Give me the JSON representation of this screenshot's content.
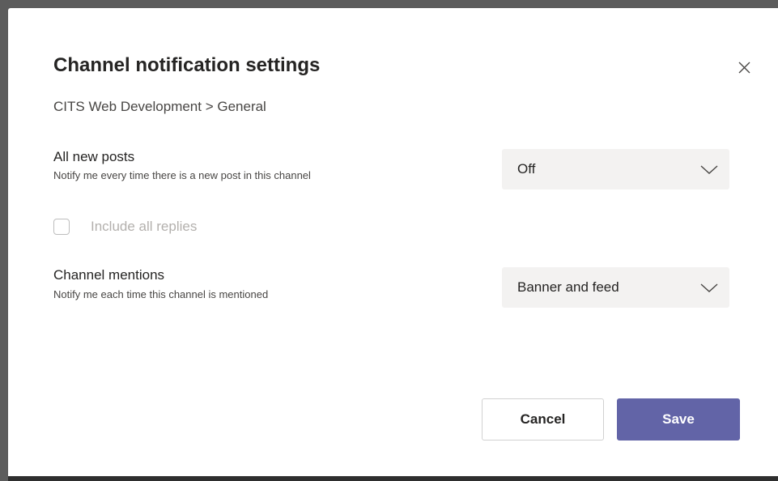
{
  "dialog": {
    "title": "Channel notification settings",
    "breadcrumb": "CITS Web Development > General",
    "close_icon": "close-icon"
  },
  "settings": {
    "all_new_posts": {
      "label": "All new posts",
      "description": "Notify me every time there is a new post in this channel",
      "selected": "Off"
    },
    "include_replies": {
      "label": "Include all replies",
      "checked": false,
      "disabled": true
    },
    "channel_mentions": {
      "label": "Channel mentions",
      "description": "Notify me each time this channel is mentioned",
      "selected": "Banner and feed"
    }
  },
  "actions": {
    "cancel_label": "Cancel",
    "save_label": "Save"
  },
  "colors": {
    "accent": "#6264a7",
    "dropdown_bg": "#f3f2f1",
    "text_primary": "#252423",
    "text_disabled": "#b3b0ad"
  }
}
